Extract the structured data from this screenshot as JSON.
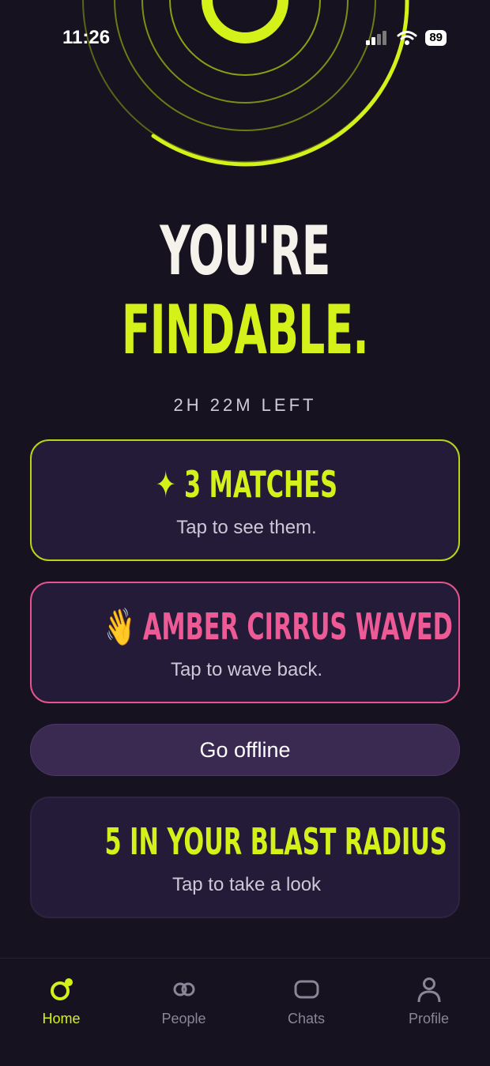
{
  "status_bar": {
    "time": "11:26",
    "battery": "89"
  },
  "hero": {
    "line1": "YOU'RE",
    "line2": "FINDABLE."
  },
  "time_left": "2H 22M LEFT",
  "matches_card": {
    "icon": "sparkle-icon",
    "title": "3 MATCHES",
    "subtitle": "Tap to see them."
  },
  "wave_card": {
    "emoji": "👋",
    "title": "AMBER CIRRUS WAVED",
    "subtitle": "Tap to wave back."
  },
  "offline_button": {
    "label": "Go offline"
  },
  "blast_card": {
    "title": "5 IN YOUR BLAST RADIUS",
    "subtitle": "Tap to take a look"
  },
  "tabs": [
    {
      "label": "Home",
      "icon": "home-ring-icon",
      "active": true
    },
    {
      "label": "People",
      "icon": "people-rings-icon",
      "active": false
    },
    {
      "label": "Chats",
      "icon": "chat-bubble-icon",
      "active": false
    },
    {
      "label": "Profile",
      "icon": "person-icon",
      "active": false
    }
  ],
  "colors": {
    "accent": "#d4f21a",
    "pink": "#ee5a95",
    "background": "#17121f",
    "card": "#231b38"
  }
}
